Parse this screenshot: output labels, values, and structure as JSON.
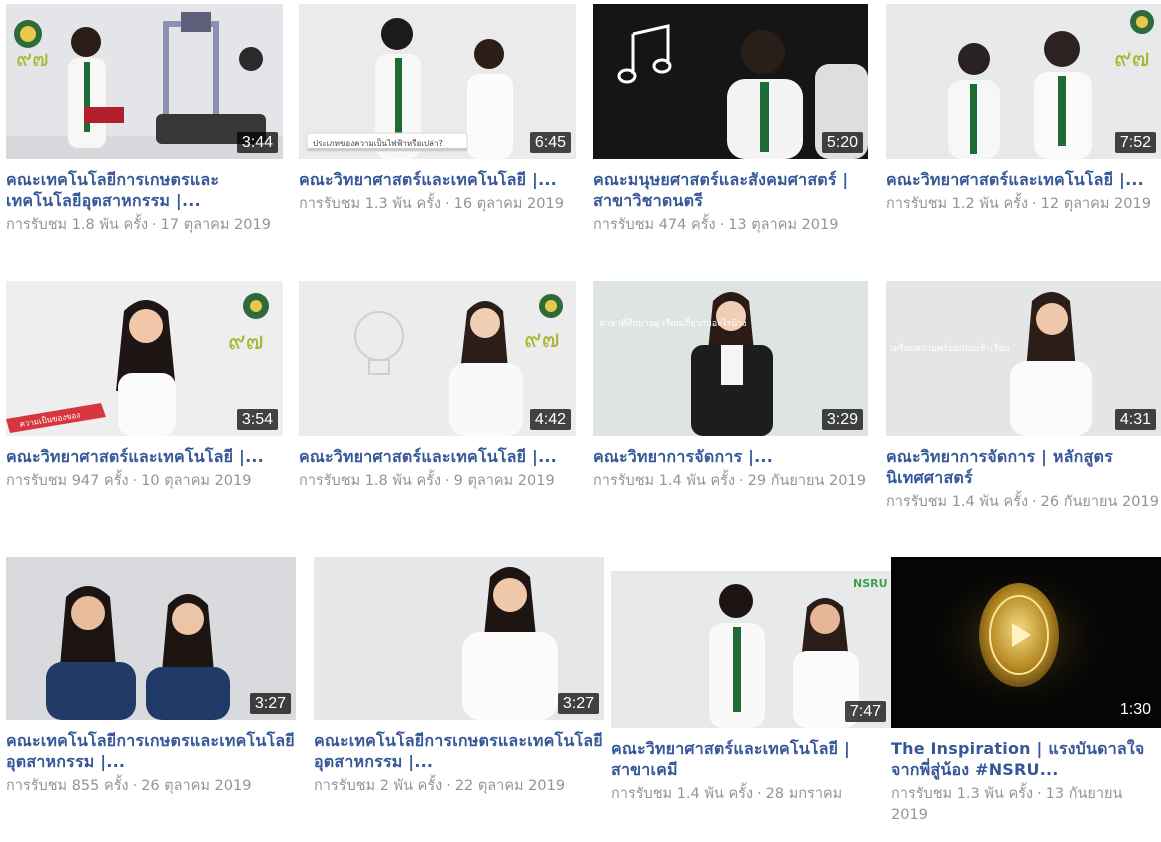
{
  "videos": [
    {
      "title": "คณะเทคโนโลยีการเกษตรและเทคโนโลยีอุตสาหกรรม |...",
      "duration": "3:44",
      "views": "การรับชม 1.8 พัน ครั้ง",
      "date": "17 ตุลาคม 2019",
      "thumb_color": "#e3e5e8"
    },
    {
      "title": "คณะวิทยาศาสตร์และเทคโนโลยี |...",
      "duration": "6:45",
      "views": "การรับชม 1.3 พัน ครั้ง",
      "date": "16 ตุลาคม 2019",
      "thumb_color": "#ebebec",
      "overlay": "ประเภทของความเป็นไฟฟ้าหรือเปล่า?"
    },
    {
      "title": "คณะมนุษยศาสตร์และสังคมศาสตร์ | สาขาวิชาดนตรี",
      "duration": "5:20",
      "views": "การรับชม 474 ครั้ง",
      "date": "13 ตุลาคม 2019",
      "thumb_color": "#151515"
    },
    {
      "title": "คณะวิทยาศาสตร์และเทคโนโลยี |...",
      "duration": "7:52",
      "views": "การรับชม 1.2 พัน ครั้ง",
      "date": "12 ตุลาคม 2019",
      "thumb_color": "#e8e9eb"
    },
    {
      "title": "คณะวิทยาศาสตร์และเทคโนโลยี |...",
      "duration": "3:54",
      "views": "การรับชม 947 ครั้ง",
      "date": "10 ตุลาคม 2019",
      "thumb_color": "#eeeeef",
      "overlay": "ความเป็นของของ"
    },
    {
      "title": "คณะวิทยาศาสตร์และเทคโนโลยี |...",
      "duration": "4:42",
      "views": "การรับชม 1.8 พัน ครั้ง",
      "date": "9 ตุลาคม 2019",
      "thumb_color": "#ececed"
    },
    {
      "title": "คณะวิทยาการจัดการ |...",
      "duration": "3:29",
      "views": "การรับชม 1.4 พัน ครั้ง",
      "date": "29 กันยายน 2019",
      "thumb_color": "#dde4e3",
      "overlay": "สาขาที่ศึกษาอยู่ เรียนเกี่ยวกับอะไรบ้าง"
    },
    {
      "title": "คณะวิทยาการจัดการ | หลักสูตรนิเทศศาสตร์",
      "duration": "4:31",
      "views": "การรับชม 1.4 พัน ครั้ง",
      "date": "26 กันยายน 2019",
      "thumb_color": "#e4e5e7",
      "overlay": "เตรียมความพร้อมก่อนเข้าเรียน"
    },
    {
      "title": "คณะเทคโนโลยีการเกษตรและเทคโนโลยีอุตสาหกรรม |...",
      "duration": "3:27",
      "views": "การรับชม 855 ครั้ง",
      "date": "26 ตุลาคม 2019",
      "thumb_color": "#d9dadd"
    },
    {
      "title": "คณะเทคโนโลยีการเกษตรและเทคโนโลยีอุตสาหกรรม |...",
      "duration": "3:27",
      "views": "การรับชม 2 พัน ครั้ง",
      "date": "22 ตุลาคม 2019",
      "thumb_color": "#e6e7e9"
    },
    {
      "title": "คณะวิทยาศาสตร์และเทคโนโลยี | สาขาเคมี",
      "duration": "7:47",
      "views": "การรับชม 1.4 พัน ครั้ง",
      "date": "28 มกราคม",
      "thumb_color": "#e8e9eb",
      "logo_text": "NSRU"
    },
    {
      "title": "The Inspiration | แรงบันดาลใจ จากพี่สู่น้อง #NSRU...",
      "duration": "1:30",
      "views": "การรับชม 1.3 พัน ครั้ง",
      "date": "13 กันยายน 2019",
      "thumb_color": "#050505"
    }
  ],
  "colors": {
    "title_link": "#365899",
    "meta_text": "#90949c",
    "accent_green": "#1f6b35",
    "gold": "#c9a227"
  }
}
